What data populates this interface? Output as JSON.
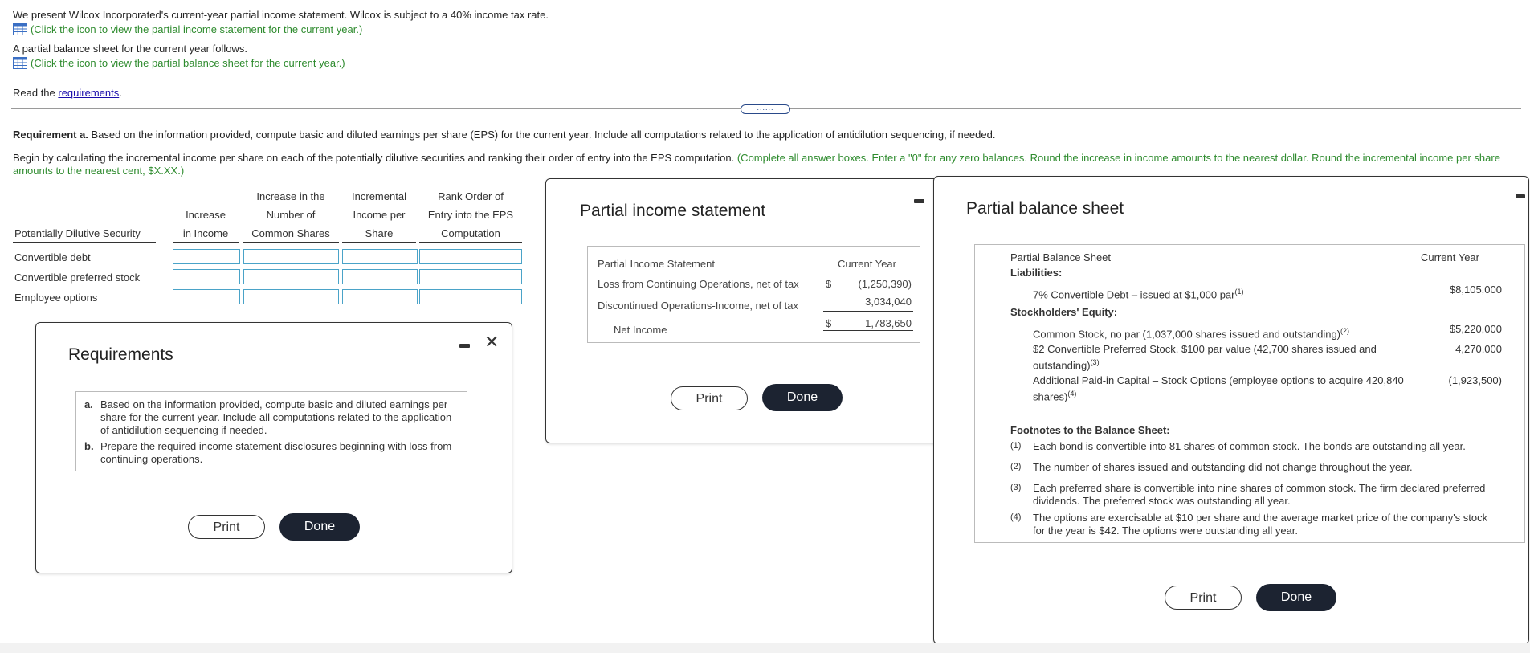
{
  "intro": {
    "line1": "We present Wilcox Incorporated's current-year partial income statement. Wilcox is subject to a 40% income tax rate.",
    "link1": "(Click the icon to view the partial income statement for the current year.)",
    "line2": "A partial balance sheet for the current year follows.",
    "link2": "(Click the icon to view the partial balance sheet for the current year.)",
    "read_prefix": "Read the ",
    "read_link": "requirements",
    "read_suffix": "."
  },
  "divider_handle": "......",
  "requirement_a": {
    "bold": "Requirement a.",
    "text": " Based on the information provided, compute basic and diluted earnings per share (EPS) for the current year. Include all computations related to the application of antidilution sequencing, if needed.",
    "begin": "Begin by calculating the incremental income per share on each of the potentially dilutive securities and ranking their order of entry into the EPS computation.",
    "instr_line1": " (Complete all answer boxes. Enter a \"0\" for any zero balances. Round the increase in income amounts to the nearest dollar. Round the incremental income per share",
    "instr_line2": "amounts to the nearest cent, $X.XX.)"
  },
  "eps_table": {
    "headers": {
      "security": "Potentially Dilutive Security",
      "increase_income": [
        "Increase",
        "in Income"
      ],
      "increase_shares": [
        "Increase in the",
        "Number of",
        "Common Shares"
      ],
      "incremental": [
        "Incremental",
        "Income per",
        "Share"
      ],
      "rank": [
        "Rank Order of",
        "Entry into the EPS",
        "Computation"
      ]
    },
    "rows": [
      "Convertible debt",
      "Convertible preferred stock",
      "Employee options"
    ]
  },
  "requirements_modal": {
    "title": "Requirements",
    "items": [
      {
        "marker": "a.",
        "text": "Based on the information provided, compute basic and diluted earnings per share for the current year. Include all computations related to the application of antidilution sequencing if needed."
      },
      {
        "marker": "b.",
        "text": "Prepare the required income statement disclosures beginning with loss from continuing operations."
      }
    ],
    "print": "Print",
    "done": "Done"
  },
  "income_modal": {
    "title": "Partial income statement",
    "header_left": "Partial Income Statement",
    "header_right": "Current Year",
    "rows": [
      {
        "label": "Loss from Continuing Operations, net of tax",
        "dollar": "$",
        "value": "(1,250,390)"
      },
      {
        "label": "Discontinued Operations-Income, net of tax",
        "dollar": "",
        "value": "3,034,040"
      },
      {
        "label": "Net Income",
        "dollar": "$",
        "value": "1,783,650"
      }
    ],
    "print": "Print",
    "done": "Done"
  },
  "balance_modal": {
    "title": "Partial balance sheet",
    "header_left": "Partial Balance Sheet",
    "header_right": "Current Year",
    "liabilities": "Liabilities:",
    "debt_label": "7% Convertible Debt – issued at $1,000 par",
    "debt_sup": "(1)",
    "debt_value": "$8,105,000",
    "equity": "Stockholders' Equity:",
    "common_label": "Common Stock, no par (1,037,000 shares issued and outstanding)",
    "common_sup": "(2)",
    "common_value": "$5,220,000",
    "pref_label_1": "$2 Convertible Preferred Stock, $100 par value (42,700 shares issued and",
    "pref_label_2": "outstanding)",
    "pref_sup": "(3)",
    "pref_value": "4,270,000",
    "apic_label_1": "Additional Paid-in Capital – Stock Options (employee options to acquire 420,840",
    "apic_label_2": "shares)",
    "apic_sup": "(4)",
    "apic_value": "(1,923,500)",
    "footnotes_title": "Footnotes to the Balance Sheet:",
    "footnotes": [
      {
        "mk": "(1)",
        "text": "Each bond is convertible into 81 shares of common stock. The bonds are outstanding all year."
      },
      {
        "mk": "(2)",
        "text": "The number of shares issued and outstanding did not change throughout the year."
      },
      {
        "mk": "(3)",
        "text_1": "Each preferred share is convertible into nine shares of common stock. The firm declared preferred",
        "text_2": "dividends. The preferred stock was outstanding all year."
      },
      {
        "mk": "(4)",
        "text_1": "The options are exercisable at $10 per share and the average market price of the company's stock",
        "text_2": "for the year is $42. The options were outstanding all year."
      }
    ],
    "print": "Print",
    "done": "Done"
  },
  "colors": {
    "green": "#2e8b2e",
    "link": "#1a0dab",
    "done_bg": "#1c2331",
    "input_border": "#4aa3c8"
  }
}
